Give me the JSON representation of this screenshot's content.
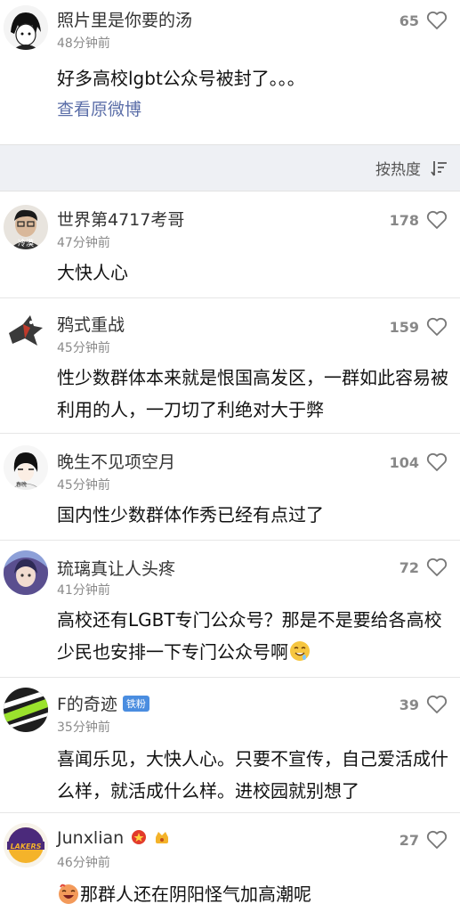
{
  "op_comment": {
    "username": "照片里是你要的汤",
    "time": "48分钟前",
    "likes": "65",
    "text": "好多高校lgbt公众号被封了。。。",
    "view_original": "查看原微博"
  },
  "sort": {
    "label": "按热度"
  },
  "comments": [
    {
      "username": "世界第4717考哥",
      "time": "47分钟前",
      "likes": "178",
      "text": "大快人心"
    },
    {
      "username": "鸦式重战",
      "time": "45分钟前",
      "likes": "159",
      "text": "性少数群体本来就是恨国高发区，一群如此容易被利用的人，一刀切了利绝对大于弊"
    },
    {
      "username": "晚生不见项空月",
      "time": "45分钟前",
      "likes": "104",
      "text": "国内性少数群体作秀已经有点过了"
    },
    {
      "username": "琉璃真让人头疼",
      "time": "41分钟前",
      "likes": "72",
      "text": "高校还有LGBT专门公众号？那是不是要给各高校少民也安排一下专门公众号啊"
    },
    {
      "username": "F的奇迹",
      "badge": "铁粉",
      "time": "35分钟前",
      "likes": "39",
      "text": "喜闻乐见，大快人心。只要不宣传，自己爱活成什么样，就活成什么样。进校园就别想了"
    },
    {
      "username": "Junxlian",
      "time": "46分钟前",
      "likes": "27",
      "text": "那群人还在阴阳怪气加高潮呢"
    }
  ],
  "colors": {
    "separator_bg": "#eef0f4",
    "link": "#5b6ea8",
    "badge_bg": "#4a8de0"
  }
}
